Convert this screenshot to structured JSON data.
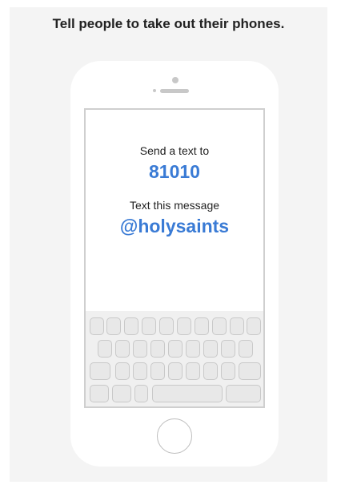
{
  "headline": "Tell people to take out their phones.",
  "screen": {
    "send_label": "Send a text to",
    "number": "81010",
    "message_label": "Text this message",
    "keyword": "@holysaints"
  },
  "colors": {
    "accent": "#3a7bd5",
    "background": "#f4f4f4",
    "text": "#222222"
  }
}
